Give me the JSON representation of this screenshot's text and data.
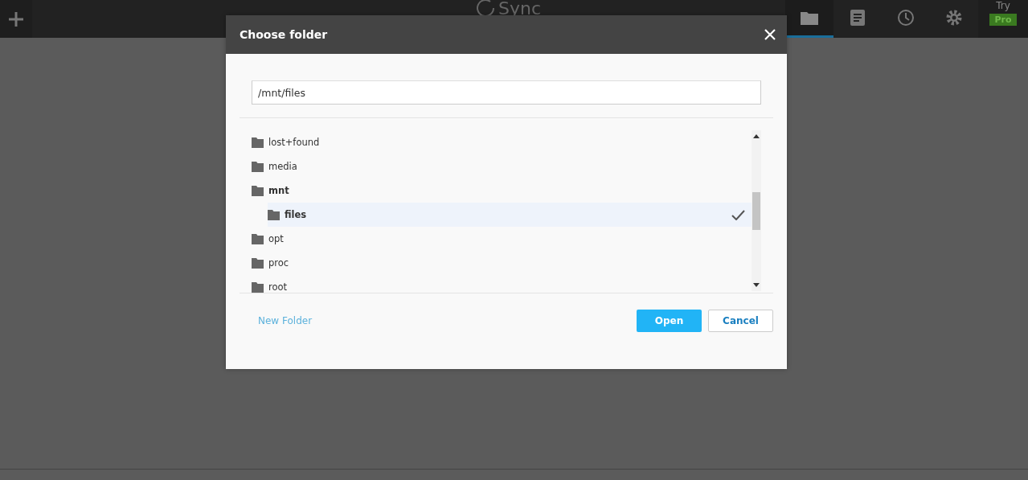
{
  "topbar": {
    "logo": "Sync",
    "nav": [
      {
        "kind": "folder",
        "selected": true
      },
      {
        "kind": "notes",
        "selected": false
      },
      {
        "kind": "history",
        "selected": false
      },
      {
        "kind": "settings",
        "selected": false
      }
    ],
    "promo": {
      "label": "Try",
      "badge": "Pro"
    }
  },
  "dialog": {
    "title": "Choose folder",
    "path": "/mnt/files",
    "tree": [
      {
        "name": "lost+found",
        "selected": false,
        "bold": false
      },
      {
        "name": "media",
        "selected": false,
        "bold": false
      },
      {
        "name": "mnt",
        "selected": false,
        "bold": true,
        "children": [
          {
            "name": "files",
            "selected": true,
            "bold": true
          }
        ]
      },
      {
        "name": "opt",
        "selected": false,
        "bold": false
      },
      {
        "name": "proc",
        "selected": false,
        "bold": false
      },
      {
        "name": "root",
        "selected": false,
        "bold": false
      }
    ],
    "new_folder": "New Folder",
    "buttons": [
      {
        "label": "Open",
        "kind": "primary"
      },
      {
        "label": "Cancel",
        "kind": "secondary"
      }
    ]
  }
}
